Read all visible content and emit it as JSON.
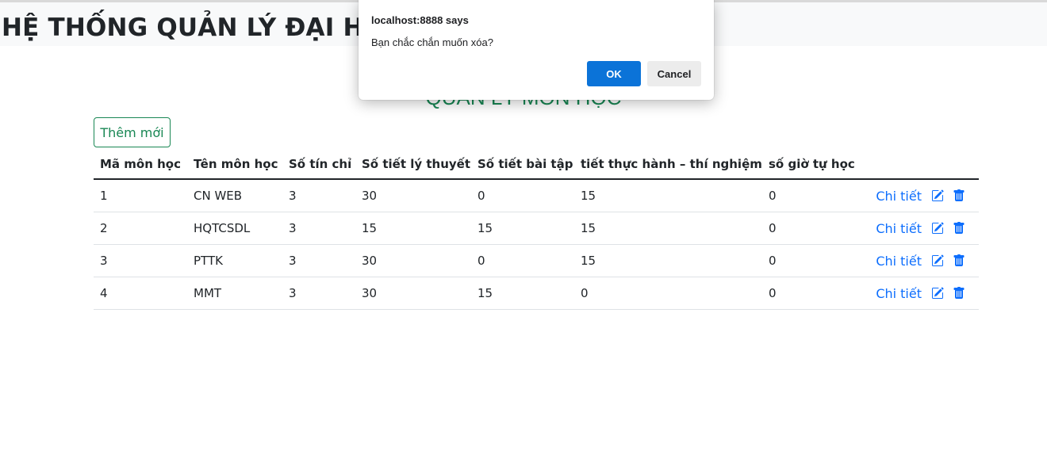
{
  "header": {
    "title": "HỆ THỐNG QUẢN LÝ ĐẠI HỌC"
  },
  "page": {
    "heading": "QUẢN LÝ MÔN HỌC",
    "add_button": "Thêm mới"
  },
  "table": {
    "columns": [
      "Mã môn học",
      "Tên môn học",
      "Số tín chỉ",
      "Số tiết lý thuyết",
      "Số tiết bài tập",
      "tiết thực hành – thí nghiệm",
      "số giờ tự học"
    ],
    "rows": [
      {
        "cells": [
          "1",
          "CN WEB",
          "3",
          "30",
          "0",
          "15",
          "0"
        ],
        "detail_link": "Chi tiết"
      },
      {
        "cells": [
          "2",
          "HQTCSDL",
          "3",
          "15",
          "15",
          "15",
          "0"
        ],
        "detail_link": "Chi tiết"
      },
      {
        "cells": [
          "3",
          "PTTK",
          "3",
          "30",
          "0",
          "15",
          "0"
        ],
        "detail_link": "Chi tiết"
      },
      {
        "cells": [
          "4",
          "MMT",
          "3",
          "30",
          "15",
          "0",
          "0"
        ],
        "detail_link": "Chi tiết"
      }
    ],
    "row_icons": [
      "edit-icon",
      "trash-icon"
    ]
  },
  "dialog": {
    "title": "localhost:8888 says",
    "message": "Bạn chắc chắn muốn xóa?",
    "ok_label": "OK",
    "cancel_label": "Cancel"
  },
  "colors": {
    "accent_green": "#198754",
    "link_blue": "#0d6efd",
    "dialog_primary": "#0b73d8"
  }
}
